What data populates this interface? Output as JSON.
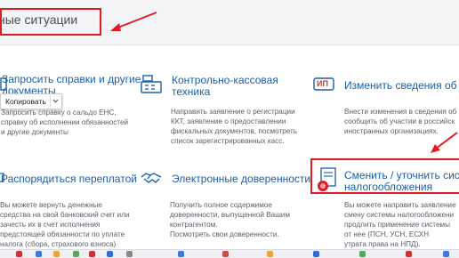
{
  "header": {
    "title": "ные ситуации"
  },
  "context_menu": {
    "copy_label": "Копировать"
  },
  "cards": [
    {
      "title_lines": [
        "Запросить справки и другие",
        "документы"
      ],
      "desc_lines": [
        "Запросить справку о сальдо ЕНС,",
        "справку об исполнении обязанностей",
        "и другие документы"
      ]
    },
    {
      "title_lines": [
        "Контрольно-кассовая",
        "техника"
      ],
      "desc_lines": [
        "Направить заявление о регистрации",
        "ККТ, заявление о предоставлении",
        "фискальных документов, посмотреть",
        "список зарегистрированных касс."
      ]
    },
    {
      "title_lines": [
        "Изменить сведения об И"
      ],
      "badge": "ИП",
      "desc_lines": [
        "Внести изменения в сведения об",
        "сообщить об участии в российск",
        "иностранных организациях."
      ]
    },
    {
      "title_lines": [
        "Распорядиться переплатой"
      ],
      "desc_lines": [
        "Вы можете вернуть денежные",
        "средства на свой банковский счет или",
        "зачесть их в счет исполнения",
        "предстоящей обязанности по уплате",
        "налога (сбора, страхового взноса)"
      ]
    },
    {
      "title_lines": [
        "Электронные доверенности"
      ],
      "desc_lines": [
        "Получить полное содержимое",
        "доверенности, выпущенной Вашим",
        "контрагентом.",
        "Посмотреть свои доверенности."
      ]
    },
    {
      "title_lines": [
        "Сменить / уточнить систе",
        "налогообложения"
      ],
      "desc_lines": [
        "Вы можете направить заявление",
        "смену системы налогообложени",
        "продлить применение системы",
        "от нее (ПСН, УСН, ЕСХН",
        "утрата права на НПД)."
      ]
    }
  ],
  "colors": {
    "accent": "#1b5fa8",
    "highlight": "#e01b24",
    "header_bg": "#f3f4f6"
  },
  "icons": [
    "building-icon",
    "cash-register-icon",
    "ip-badge-icon",
    "coins-icon",
    "handshake-icon",
    "document-stamp-icon"
  ]
}
